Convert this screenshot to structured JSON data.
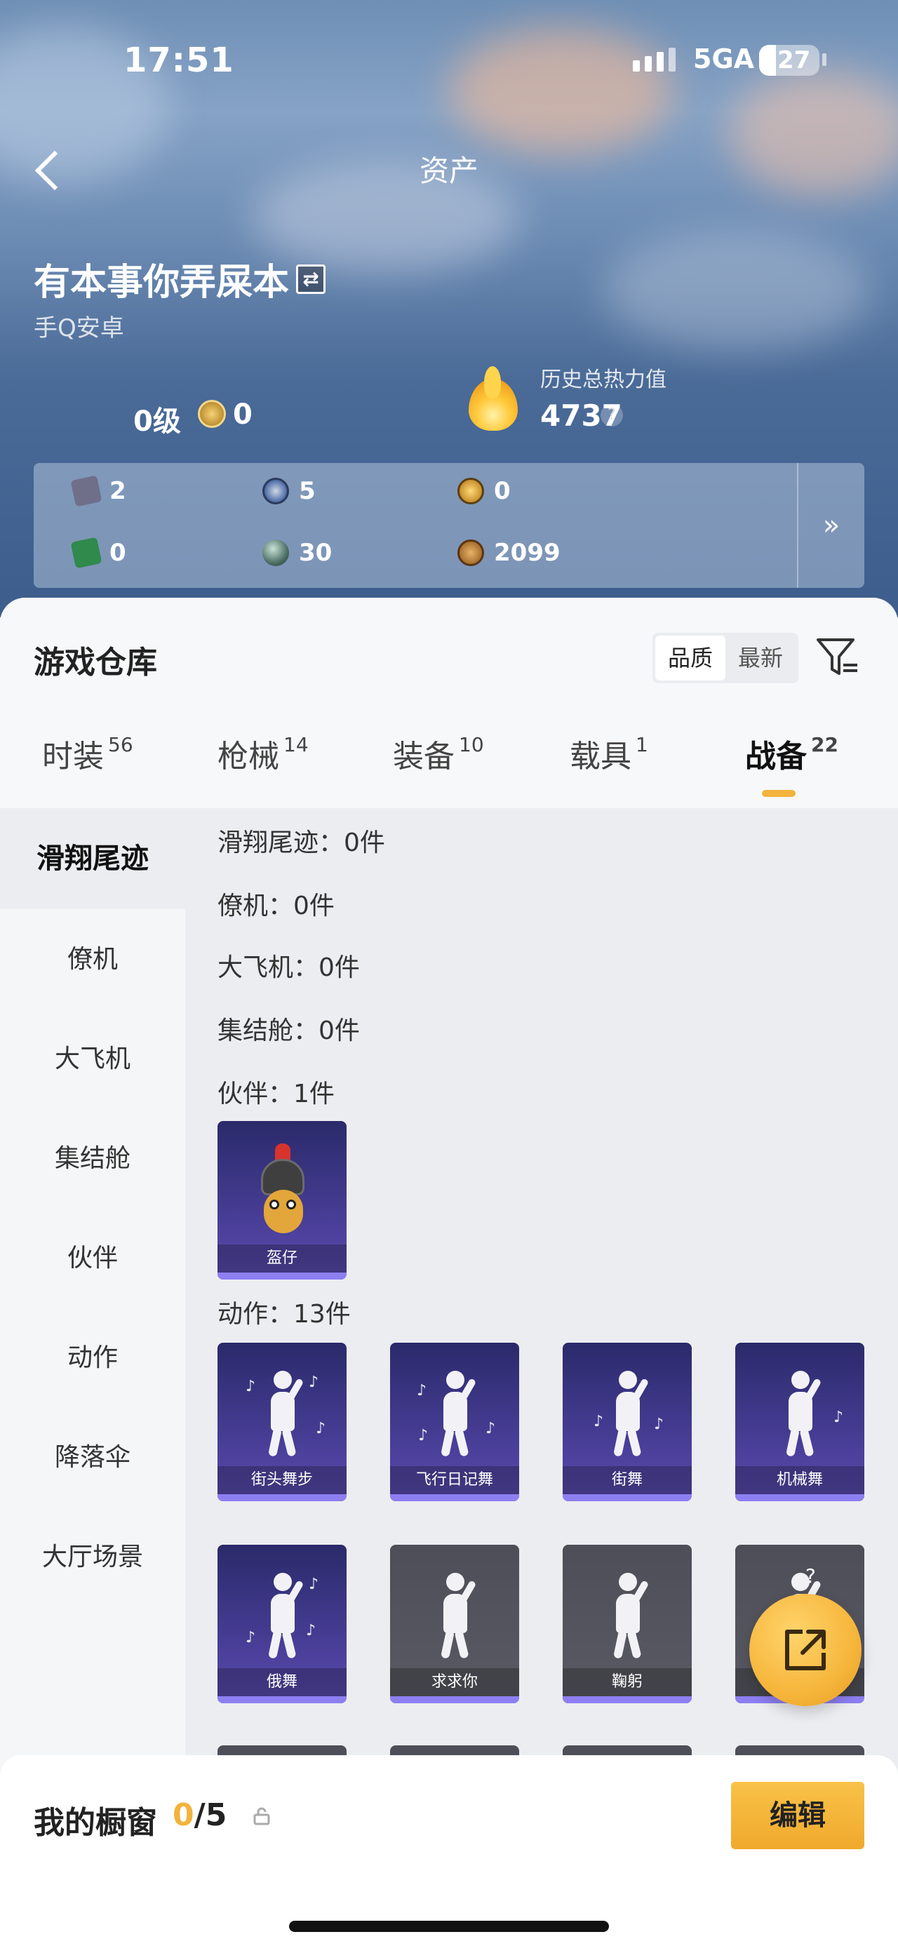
{
  "status_bar": {
    "time": "17:51",
    "network": "5GA",
    "battery": "27"
  },
  "header": {
    "title": "资产"
  },
  "player": {
    "name": "有本事你弄屎本",
    "platform": "手Q安卓",
    "platform_status": "",
    "level": "0级",
    "rank_value": "0",
    "power_label": "历史总热力值",
    "power_value": "4737",
    "power_help": "?"
  },
  "currencies": [
    {
      "icon": "card-icon",
      "value": "2",
      "color": "#6f6f8a"
    },
    {
      "icon": "coin-silver-icon",
      "value": "5",
      "color": "#4b6aa5"
    },
    {
      "icon": "coin-gold-icon",
      "value": "0",
      "color": "#c8902c"
    },
    {
      "icon": "green-card-icon",
      "value": "0",
      "color": "#2f8a4c"
    },
    {
      "icon": "orb-icon",
      "value": "30",
      "color": "#4c6f66"
    },
    {
      "icon": "bronze-coin-icon",
      "value": "2099",
      "color": "#a86f2d"
    }
  ],
  "currency_more": "»",
  "warehouse": {
    "title": "游戏仓库",
    "sort": [
      "品质",
      "最新"
    ],
    "tabs": [
      {
        "label": "时装",
        "count": "56"
      },
      {
        "label": "枪械",
        "count": "14"
      },
      {
        "label": "装备",
        "count": "10"
      },
      {
        "label": "载具",
        "count": "1"
      },
      {
        "label": "战备",
        "count": "22"
      }
    ],
    "side_nav": [
      "滑翔尾迹",
      "僚机",
      "大飞机",
      "集结舱",
      "伙伴",
      "动作",
      "降落伞",
      "大厅场景"
    ],
    "sections": {
      "glide": "滑翔尾迹：0件",
      "wingman": "僚机：0件",
      "plane": "大飞机：0件",
      "pod": "集结舱：0件",
      "partner": "伙伴：1件",
      "action": "动作：13件"
    },
    "partner_items": [
      "盔仔"
    ],
    "action_items": [
      "街头舞步",
      "飞行日记舞",
      "街舞",
      "机械舞",
      "俄舞",
      "求求你",
      "鞠躬",
      ""
    ]
  },
  "showcase": {
    "title": "我的橱窗",
    "current": "0",
    "total": "/5",
    "edit_label": "编辑"
  },
  "accent_color": "#f3b33c"
}
